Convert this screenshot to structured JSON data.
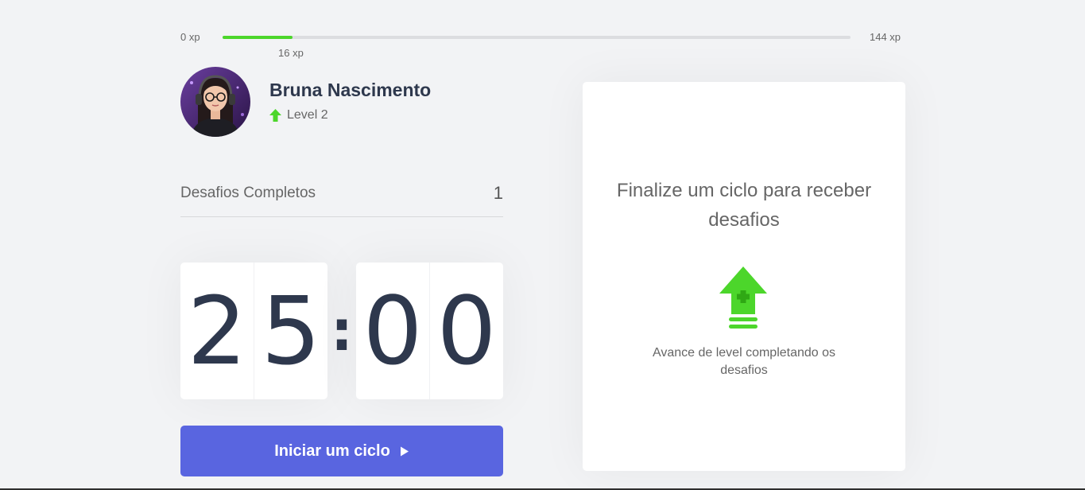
{
  "xp": {
    "start_label": "0 xp",
    "end_label": "144 xp",
    "current_label": "16 xp",
    "current": 16,
    "max": 144
  },
  "profile": {
    "name": "Bruna Nascimento",
    "level_label": "Level 2",
    "avatar_icon": "avatar-icon",
    "level_icon": "level-up-arrow-icon"
  },
  "challenges": {
    "completed_label": "Desafios Completos",
    "completed_count": "1"
  },
  "countdown": {
    "minute_tens": "2",
    "minute_ones": "5",
    "separator": ":",
    "second_tens": "0",
    "second_ones": "0"
  },
  "start_button": {
    "label": "Iniciar um ciclo",
    "icon": "play-icon"
  },
  "challenge_box": {
    "title": "Finalize um ciclo para receber desafios",
    "description": "Avance de level completando os desafios",
    "icon": "level-up-icon"
  },
  "colors": {
    "background": "#f2f3f5",
    "accent_green": "#4cd62b",
    "button_blue": "#5965e0",
    "title_dark": "#2e384d",
    "text": "#666666"
  }
}
